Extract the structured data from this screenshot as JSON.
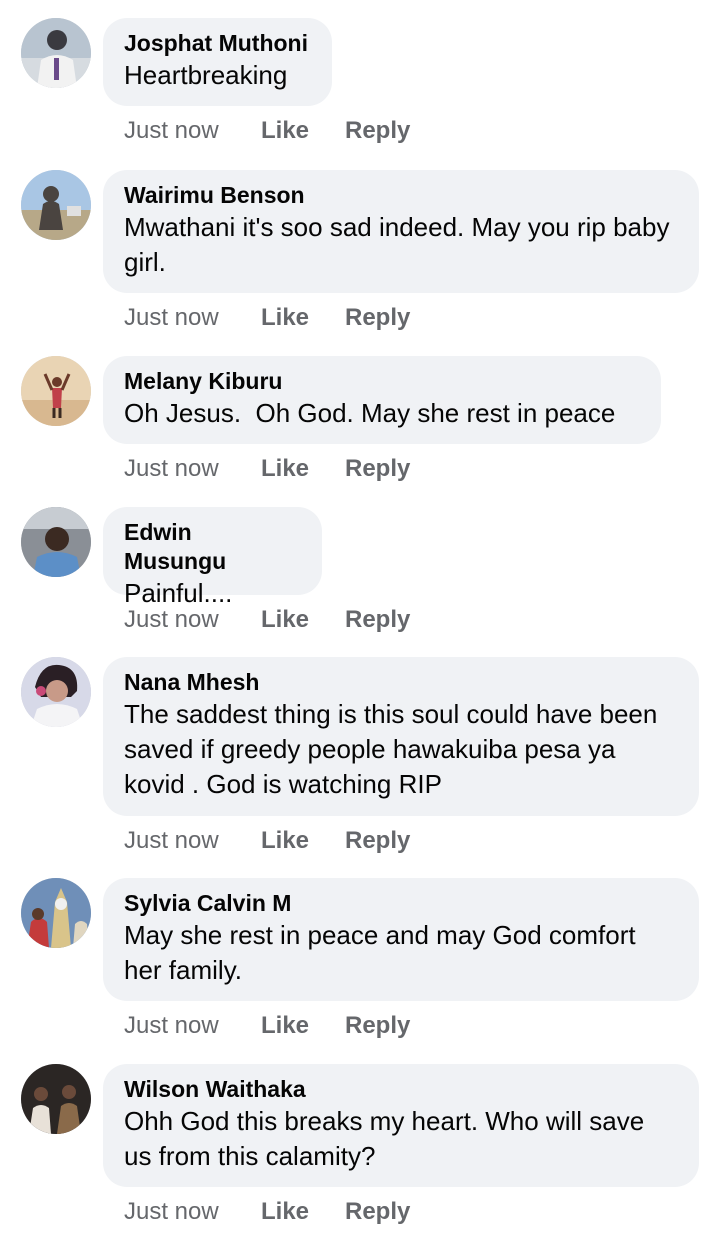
{
  "comments": [
    {
      "author": "Josphat Muthoni",
      "text": "Heartbreaking",
      "time": "Just now",
      "like": "Like",
      "reply": "Reply",
      "avatar_colors": {
        "bg": "#b8c4d0",
        "fg": "#3a3a40",
        "accent": "#f2f2f2"
      }
    },
    {
      "author": "Wairimu Benson",
      "text": "Mwathani it's soo sad indeed. May you rip baby girl.",
      "time": "Just now",
      "like": "Like",
      "reply": "Reply",
      "avatar_colors": {
        "bg": "#a9c6e4",
        "fg": "#4a4440",
        "accent": "#b7a888"
      }
    },
    {
      "author": "Melany Kiburu",
      "text": "Oh Jesus.  Oh God. May she rest in peace",
      "time": "Just now",
      "like": "Like",
      "reply": "Reply",
      "avatar_colors": {
        "bg": "#e9d4b4",
        "fg": "#6b3a2a",
        "accent": "#d8b890"
      }
    },
    {
      "author": "Edwin Musungu",
      "text": "Painful....",
      "time": "Just now",
      "like": "Like",
      "reply": "Reply",
      "avatar_colors": {
        "bg": "#8a8f96",
        "fg": "#3b2a22",
        "accent": "#5c8fc7"
      }
    },
    {
      "author": "Nana Mhesh",
      "text": "The saddest thing is this soul could have been saved if greedy people hawakuiba pesa ya kovid . God is watching RIP",
      "time": "Just now",
      "like": "Like",
      "reply": "Reply",
      "avatar_colors": {
        "bg": "#d7d9e8",
        "fg": "#2a1f25",
        "accent": "#c94a78"
      }
    },
    {
      "author": "Sylvia Calvin M",
      "text": "May she rest in peace and may God comfort her family.",
      "time": "Just now",
      "like": "Like",
      "reply": "Reply",
      "avatar_colors": {
        "bg": "#6f8fb8",
        "fg": "#d9c48a",
        "accent": "#c43b3b"
      }
    },
    {
      "author": "Wilson Waithaka",
      "text": "Ohh God this breaks my heart. Who will save us from this calamity?",
      "time": "Just now",
      "like": "Like",
      "reply": "Reply",
      "avatar_colors": {
        "bg": "#2b2624",
        "fg": "#e8e1d8",
        "accent": "#8a6a4a"
      }
    }
  ]
}
